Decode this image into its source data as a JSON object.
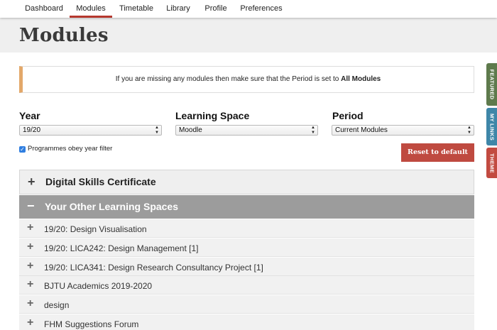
{
  "nav": {
    "tabs": [
      {
        "label": "Dashboard",
        "active": false
      },
      {
        "label": "Modules",
        "active": true
      },
      {
        "label": "Timetable",
        "active": false
      },
      {
        "label": "Library",
        "active": false
      },
      {
        "label": "Profile",
        "active": false
      },
      {
        "label": "Preferences",
        "active": false
      }
    ]
  },
  "page": {
    "title": "Modules"
  },
  "notice": {
    "text": "If you are missing any modules then make sure that the Period is set to ",
    "highlight": "All Modules",
    "accent_color": "#e3a86a"
  },
  "filters": {
    "year": {
      "label": "Year",
      "value": "19/20"
    },
    "learning_space": {
      "label": "Learning Space",
      "value": "Moodle"
    },
    "period": {
      "label": "Period",
      "value": "Current Modules"
    },
    "checkbox": {
      "label": "Programmes obey year filter",
      "checked": true
    },
    "reset_label": "Reset to default"
  },
  "sections": {
    "digital": {
      "label": "Digital Skills Certificate",
      "expanded": false
    },
    "other": {
      "label": "Your Other Learning Spaces",
      "expanded": true,
      "items": [
        "19/20: Design Visualisation",
        "19/20: LICA242: Design Management [1]",
        "19/20: LICA341: Design Research Consultancy Project [1]",
        "BJTU Academics 2019-2020",
        "design",
        "FHM Suggestions Forum"
      ]
    }
  },
  "side_tabs": [
    {
      "label": "FEATURED",
      "color": "#5e7a4c"
    },
    {
      "label": "MY LINKS",
      "color": "#3e86a8"
    },
    {
      "label": "THEME",
      "color": "#c24a40"
    }
  ],
  "colors": {
    "brand": "#b5382e",
    "reset": "#bf4a40"
  }
}
